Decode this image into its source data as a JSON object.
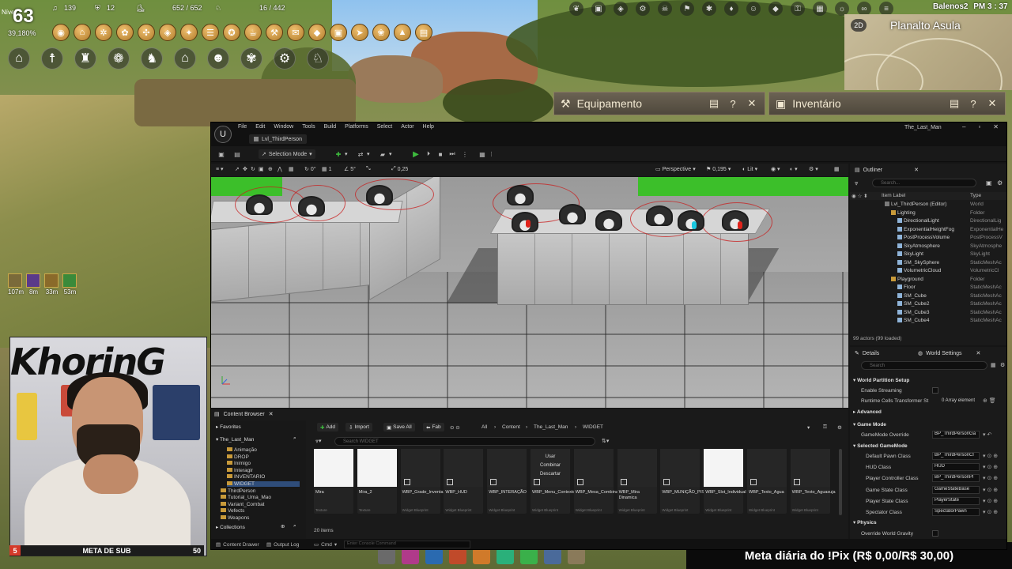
{
  "hud": {
    "level_label": "Nível",
    "level": "63",
    "xp_percent": "39,180%",
    "stats": [
      {
        "icon": "music-note-icon",
        "value": "139"
      },
      {
        "icon": "shield-icon",
        "value": "12"
      },
      {
        "icon": "boot-icon",
        "value": ""
      },
      {
        "icon": "weight-icon",
        "value": "652 / 652"
      },
      {
        "icon": "rabbit-icon",
        "value": "16 / 442"
      }
    ],
    "buffs": [
      {
        "icon": "buff-claw-icon",
        "time": "107m",
        "color": "#7a6a3a"
      },
      {
        "icon": "buff-moon-icon",
        "time": "8m",
        "color": "#5a3a8a"
      },
      {
        "icon": "buff-fire-icon",
        "time": "33m",
        "color": "#8a6a2a"
      },
      {
        "icon": "buff-leaf-icon",
        "time": "53m",
        "color": "#3a8a3a"
      }
    ],
    "row1_icons": [
      "shield-gold-icon",
      "helmet-icon",
      "gear-gold-icon",
      "paw-gold-icon",
      "compass-icon",
      "coin-icon",
      "badge-icon",
      "scroll-icon",
      "pet-icon",
      "food-icon",
      "hammer-icon",
      "mail-icon",
      "drop-icon",
      "card-icon",
      "arrow-icon",
      "flower-icon",
      "tent-icon",
      "chest-icon"
    ],
    "row2_icons": [
      "house-icon",
      "scarecrow-icon",
      "castle-icon",
      "paw-icon",
      "horse-icon",
      "camp-icon",
      "group-icon",
      "butterfly-icon",
      "tools-icon",
      "gallop-icon"
    ]
  },
  "topright": {
    "player": "Balenos2",
    "clock": "PM 3 : 37",
    "map_mode": "2D",
    "region": "Planalto Asula"
  },
  "panels": {
    "equipment": "Equipamento",
    "inventory": "Inventário",
    "help": "?",
    "close": "✕"
  },
  "stream": {
    "channel_logo": "KhorinG",
    "sub_current": "5",
    "sub_label": "META DE SUB",
    "sub_goal": "50",
    "pix_goal": "Meta diária do !Pix (R$ 0,00/R$ 30,00)"
  },
  "ue": {
    "menu": [
      "File",
      "Edit",
      "Window",
      "Tools",
      "Build",
      "Platforms",
      "Select",
      "Actor",
      "Help"
    ],
    "level_tab": "Lvl_ThirdPerson",
    "project": "The_Last_Man",
    "selection_mode": "Selection Mode",
    "viewport": {
      "perspective": "Perspective",
      "lit": "Lit",
      "speed": "0,195",
      "snap1": "0°",
      "snap2": "1",
      "snap3": "5°",
      "snap4": "0,25"
    },
    "outliner": {
      "title": "Outliner",
      "search_placeholder": "Search...",
      "col_label": "Item Label",
      "col_type": "Type",
      "rows": [
        {
          "name": "Lvl_ThirdPerson (Editor)",
          "type": "World",
          "indent": 0
        },
        {
          "name": "Lighting",
          "type": "Folder",
          "indent": 1
        },
        {
          "name": "DirectionalLight",
          "type": "DirectionalLig",
          "indent": 2
        },
        {
          "name": "ExponentialHeightFog",
          "type": "ExponentialHe",
          "indent": 2
        },
        {
          "name": "PostProcessVolume",
          "type": "PostProcessV",
          "indent": 2
        },
        {
          "name": "SkyAtmosphere",
          "type": "SkyAtmosphe",
          "indent": 2
        },
        {
          "name": "SkyLight",
          "type": "SkyLight",
          "indent": 2
        },
        {
          "name": "SM_SkySphere",
          "type": "StaticMeshAc",
          "indent": 2
        },
        {
          "name": "VolumetricCloud",
          "type": "VolumetricCl",
          "indent": 2
        },
        {
          "name": "Playground",
          "type": "Folder",
          "indent": 1
        },
        {
          "name": "Floor",
          "type": "StaticMeshAc",
          "indent": 2
        },
        {
          "name": "SM_Cube",
          "type": "StaticMeshAc",
          "indent": 2
        },
        {
          "name": "SM_Cube2",
          "type": "StaticMeshAc",
          "indent": 2
        },
        {
          "name": "SM_Cube3",
          "type": "StaticMeshAc",
          "indent": 2
        },
        {
          "name": "SM_Cube4",
          "type": "StaticMeshAc",
          "indent": 2
        }
      ],
      "footer": "99 actors (99 loaded)"
    },
    "details": {
      "tab_details": "Details",
      "tab_world": "World Settings",
      "search_placeholder": "Search",
      "sections": [
        {
          "title": "World Partition Setup"
        },
        {
          "title": "Advanced"
        },
        {
          "title": "Game Mode"
        },
        {
          "title": "Selected GameMode"
        },
        {
          "title": "Physics"
        }
      ],
      "enable_streaming": "Enable Streaming",
      "runtime_cells": "Runtime Cells Transformer St",
      "runtime_cells_val": "0 Array element",
      "gamemode_override": "GameMode Override",
      "gamemode_val": "BP_ThirdPersonGa",
      "classes": [
        {
          "label": "Default Pawn Class",
          "value": "BP_ThirdPersonCl"
        },
        {
          "label": "HUD Class",
          "value": "HUD"
        },
        {
          "label": "Player Controller Class",
          "value": "BP_ThirdPersonPl"
        },
        {
          "label": "Game State Class",
          "value": "GameStateBase"
        },
        {
          "label": "Player State Class",
          "value": "PlayerState"
        },
        {
          "label": "Spectator Class",
          "value": "SpectatorPawn"
        }
      ],
      "override_gravity": "Override World Gravity"
    },
    "content_browser": {
      "title": "Content Browser",
      "favorites": "Favorites",
      "project_root": "The_Last_Man",
      "collections": "Collections",
      "tree": [
        "Animação",
        "DROP",
        "Inimigo",
        "Interagir",
        "INVENTARIO",
        "WIDGET",
        "ThirdPerson",
        "Tutorial_Uma_Mao",
        "Variant_Combat",
        "Vefects",
        "Weapons"
      ],
      "add": "Add",
      "import": "Import",
      "save_all": "Save All",
      "fab": "Fab",
      "crumbs": [
        "All",
        "Content",
        "The_Last_Man",
        "WIDGET"
      ],
      "search_placeholder": "Search WIDGET",
      "assets": [
        {
          "name": "Mira",
          "kind": "Texture",
          "white": true
        },
        {
          "name": "Mira_2",
          "kind": "Texture",
          "white": true
        },
        {
          "name": "WBP_Grade_Inventario",
          "kind": "Widget Blueprint",
          "white": false
        },
        {
          "name": "WBP_HUD",
          "kind": "Widget Blueprint",
          "white": false
        },
        {
          "name": "WBP_INTERAÇÃO",
          "kind": "Widget Blueprint",
          "white": false
        },
        {
          "name": "WBP_Menu_Contexto",
          "kind": "Widget Blueprint",
          "white": false
        },
        {
          "name": "WBP_Mesa_Combinação",
          "kind": "Widget Blueprint",
          "white": false
        },
        {
          "name": "WBP_Mira Dinamica",
          "kind": "Widget Blueprint",
          "white": false
        },
        {
          "name": "WBP_MUNIÇÃO_PISTOLA",
          "kind": "Widget Blueprint",
          "white": false
        },
        {
          "name": "WBP_Slot_Individual",
          "kind": "Widget Blueprint",
          "white": true
        },
        {
          "name": "WBP_Texto_Agua",
          "kind": "Widget Blueprint",
          "white": false
        },
        {
          "name": "WBP_Texto_Aguasuja",
          "kind": "Widget Blueprint",
          "white": false
        }
      ],
      "context_menu": [
        "Usar",
        "Combinar",
        "Descartar"
      ],
      "count": "20 items"
    },
    "statusbar": {
      "content_drawer": "Content Drawer",
      "output_log": "Output Log",
      "cmd": "Cmd",
      "console_placeholder": "Enter Console Command"
    }
  }
}
